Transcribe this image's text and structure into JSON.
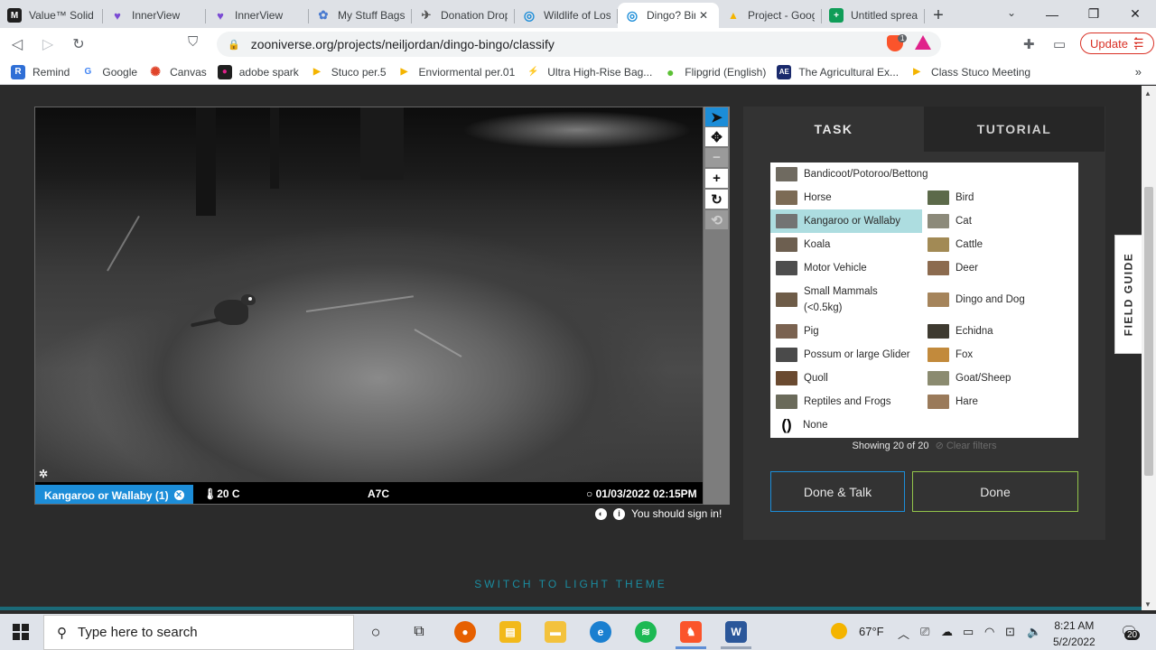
{
  "browser": {
    "tabs": [
      {
        "title": "Value™ Solid Y",
        "icon": "M",
        "color": "#1f1f1f"
      },
      {
        "title": "InnerView",
        "icon": "♥",
        "color": "#7b4bd4"
      },
      {
        "title": "InnerView",
        "icon": "♥",
        "color": "#7b4bd4"
      },
      {
        "title": "My Stuff Bags",
        "icon": "✿",
        "color": "#4a7bd0"
      },
      {
        "title": "Donation Drop",
        "icon": "✈",
        "color": "#555555"
      },
      {
        "title": "Wildlife of Los",
        "icon": "◎",
        "color": "#1c8dd8"
      },
      {
        "title": "Dingo? Bingo!",
        "icon": "◎",
        "color": "#1c8dd8",
        "active": true
      },
      {
        "title": "Project - Goog",
        "icon": "▲",
        "color": "#f4b400"
      },
      {
        "title": "Untitled sprea",
        "icon": "+",
        "color": "#0f9d58"
      }
    ],
    "url": "zooniverse.org/projects/neiljordan/dingo-bingo/classify",
    "brave_count": "1",
    "update_label": "Update",
    "bookmarks": [
      {
        "label": "Remind",
        "icon": "R",
        "color": "#2f6fd6"
      },
      {
        "label": "Google",
        "icon": "G",
        "color": "#4285f4"
      },
      {
        "label": "Canvas",
        "icon": "✺",
        "color": "#e0442a"
      },
      {
        "label": "adobe spark",
        "icon": "●",
        "color": "#1f1f1f"
      },
      {
        "label": "Stuco per.5",
        "icon": "▶",
        "color": "#f4b400"
      },
      {
        "label": "Enviormental per.01",
        "icon": "▶",
        "color": "#f4b400"
      },
      {
        "label": "Ultra High-Rise Bag...",
        "icon": "⚡",
        "color": "#f2a83b"
      },
      {
        "label": "Flipgrid (English)",
        "icon": "●",
        "color": "#5cc135"
      },
      {
        "label": "The Agricultural Ex...",
        "icon": "AE",
        "color": "#1a2a6c"
      },
      {
        "label": "Class Stuco Meeting",
        "icon": "▶",
        "color": "#f4b400"
      }
    ]
  },
  "viewer": {
    "temperature": "20 C",
    "camera": "A7C",
    "timestamp": "01/03/2022  02:15PM",
    "tag_label": "Kangaroo or Wallaby (1)",
    "signin_text": "You should sign in!"
  },
  "task": {
    "tab_task": "TASK",
    "tab_tutorial": "TUTORIAL",
    "choices": [
      {
        "label": "Bandicoot/Potoroo/Bettong",
        "color": "#6f6a60"
      },
      {
        "label": "Horse",
        "color": "#7c6b55"
      },
      {
        "label": "Bird",
        "color": "#5c6a4a"
      },
      {
        "label": "Kangaroo or Wallaby",
        "color": "#737373",
        "selected": true
      },
      {
        "label": "Cat",
        "color": "#8c8a7a"
      },
      {
        "label": "Koala",
        "color": "#6d5f50"
      },
      {
        "label": "Cattle",
        "color": "#a28a55"
      },
      {
        "label": "Motor Vehicle",
        "color": "#4d4d4d"
      },
      {
        "label": "Deer",
        "color": "#8c6b4f"
      },
      {
        "label": "Small Mammals (<0.5kg)",
        "color": "#6e5c48"
      },
      {
        "label": "Dingo and Dog",
        "color": "#a5845b"
      },
      {
        "label": "Pig",
        "color": "#7a6250"
      },
      {
        "label": "Echidna",
        "color": "#3e3a30"
      },
      {
        "label": "Possum or large Glider",
        "color": "#4a4a4a"
      },
      {
        "label": "Fox",
        "color": "#c28a3c"
      },
      {
        "label": "Quoll",
        "color": "#6a4a30"
      },
      {
        "label": "Goat/Sheep",
        "color": "#8b8b70"
      },
      {
        "label": "Reptiles and Frogs",
        "color": "#6a6a5a"
      },
      {
        "label": "Hare",
        "color": "#9a7a5a"
      },
      {
        "label": "None",
        "color": "#ffffff"
      }
    ],
    "showing_text": "Showing 20 of 20",
    "clear_filters": "Clear filters",
    "done_talk_label": "Done & Talk",
    "done_label": "Done",
    "field_guide_label": "FIELD GUIDE",
    "theme_switch_label": "SWITCH TO LIGHT THEME"
  },
  "taskbar": {
    "search_placeholder": "Type here to search",
    "weather": "67°F",
    "time": "8:21 AM",
    "date": "5/2/2022",
    "notification_count": "20"
  },
  "colors": {
    "accent_blue": "#1c8dd8",
    "done_green": "#93c44a",
    "selected_choice": "#addde0"
  }
}
